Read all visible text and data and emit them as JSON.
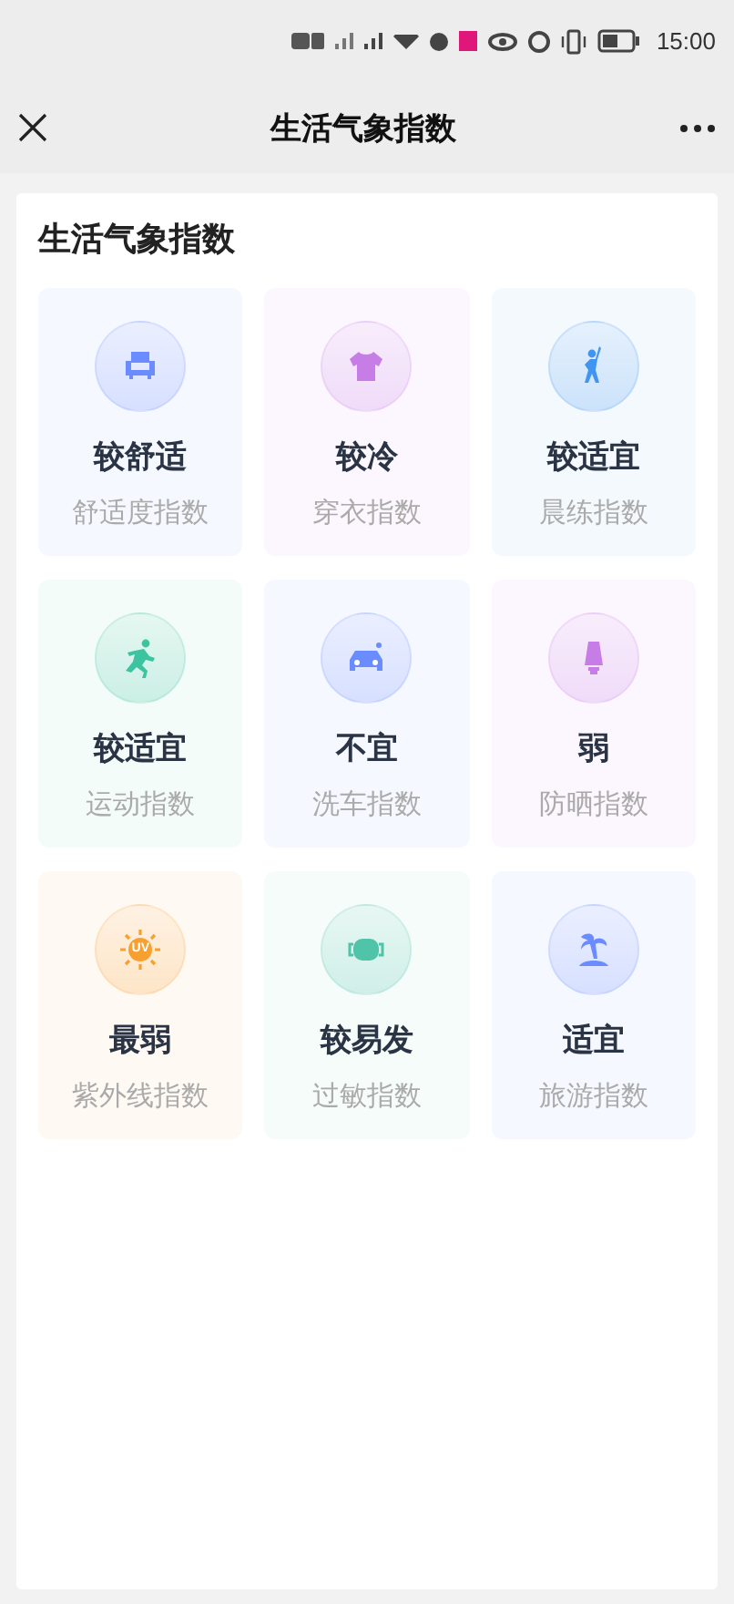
{
  "status_bar": {
    "time": "15:00"
  },
  "nav": {
    "title": "生活气象指数"
  },
  "panel": {
    "title": "生活气象指数",
    "items": [
      {
        "kind": "sofa",
        "color": "#6b8cff",
        "value": "较舒适",
        "label": "舒适度指数"
      },
      {
        "kind": "shirt",
        "color": "#c77de6",
        "value": "较冷",
        "label": "穿衣指数"
      },
      {
        "kind": "exercise",
        "color": "#3f95ef",
        "value": "较适宜",
        "label": "晨练指数"
      },
      {
        "kind": "run",
        "color": "#3cc4a0",
        "value": "较适宜",
        "label": "运动指数"
      },
      {
        "kind": "car",
        "color": "#6b8cff",
        "value": "不宜",
        "label": "洗车指数"
      },
      {
        "kind": "sunscreen",
        "color": "#c77de6",
        "value": "弱",
        "label": "防晒指数"
      },
      {
        "kind": "uv",
        "color": "#f7a030",
        "value": "最弱",
        "label": "紫外线指数",
        "icon_text": "UV"
      },
      {
        "kind": "mask",
        "color": "#4fc4a8",
        "value": "较易发",
        "label": "过敏指数"
      },
      {
        "kind": "palm",
        "color": "#6b8cff",
        "value": "适宜",
        "label": "旅游指数"
      }
    ]
  }
}
